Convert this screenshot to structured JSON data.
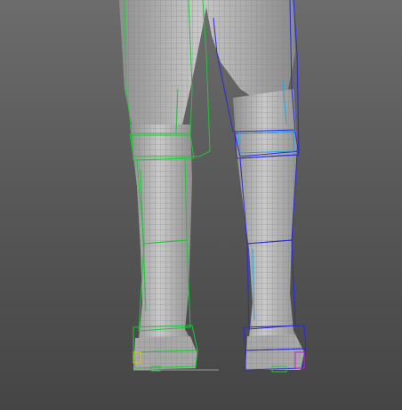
{
  "viewport": {
    "background_top": "#6c6c6c",
    "background_bottom": "#454545",
    "mesh_color": "#bdbdbd",
    "wire_color": "#7a7a7a"
  },
  "left_bone_chain": {
    "color": "#22c43a",
    "foot_accent": "#d8c800"
  },
  "right_bone_chain": {
    "color": "#2a2ad6",
    "accent": "#27a4d8",
    "foot_accent": "#c020c0"
  }
}
